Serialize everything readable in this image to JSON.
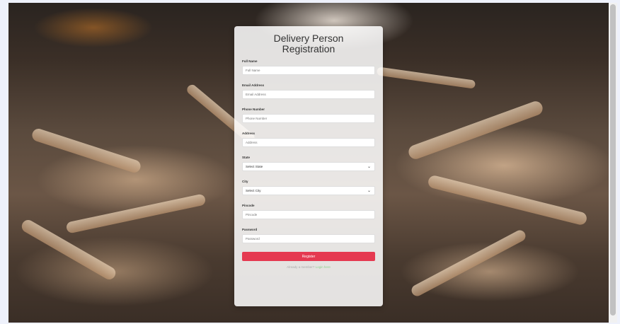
{
  "form": {
    "title_line1": "Delivery Person",
    "title_line2": "Registration",
    "fields": [
      {
        "label": "Full Name",
        "placeholder": "Full Name"
      },
      {
        "label": "Email Address",
        "placeholder": "Email Address"
      },
      {
        "label": "Phone Number",
        "placeholder": "Phone Number"
      },
      {
        "label": "Address",
        "placeholder": "Address"
      }
    ],
    "state": {
      "label": "State",
      "value": "Select State"
    },
    "city": {
      "label": "City",
      "value": "Select City"
    },
    "pincode": {
      "label": "Pincode",
      "placeholder": "Pincode"
    },
    "password": {
      "label": "Password",
      "placeholder": "Password"
    },
    "submit_label": "Register",
    "footer_text": "Already a member?",
    "footer_link": "Login here"
  },
  "colors": {
    "accent": "#e53950",
    "link": "#8fd18f"
  }
}
